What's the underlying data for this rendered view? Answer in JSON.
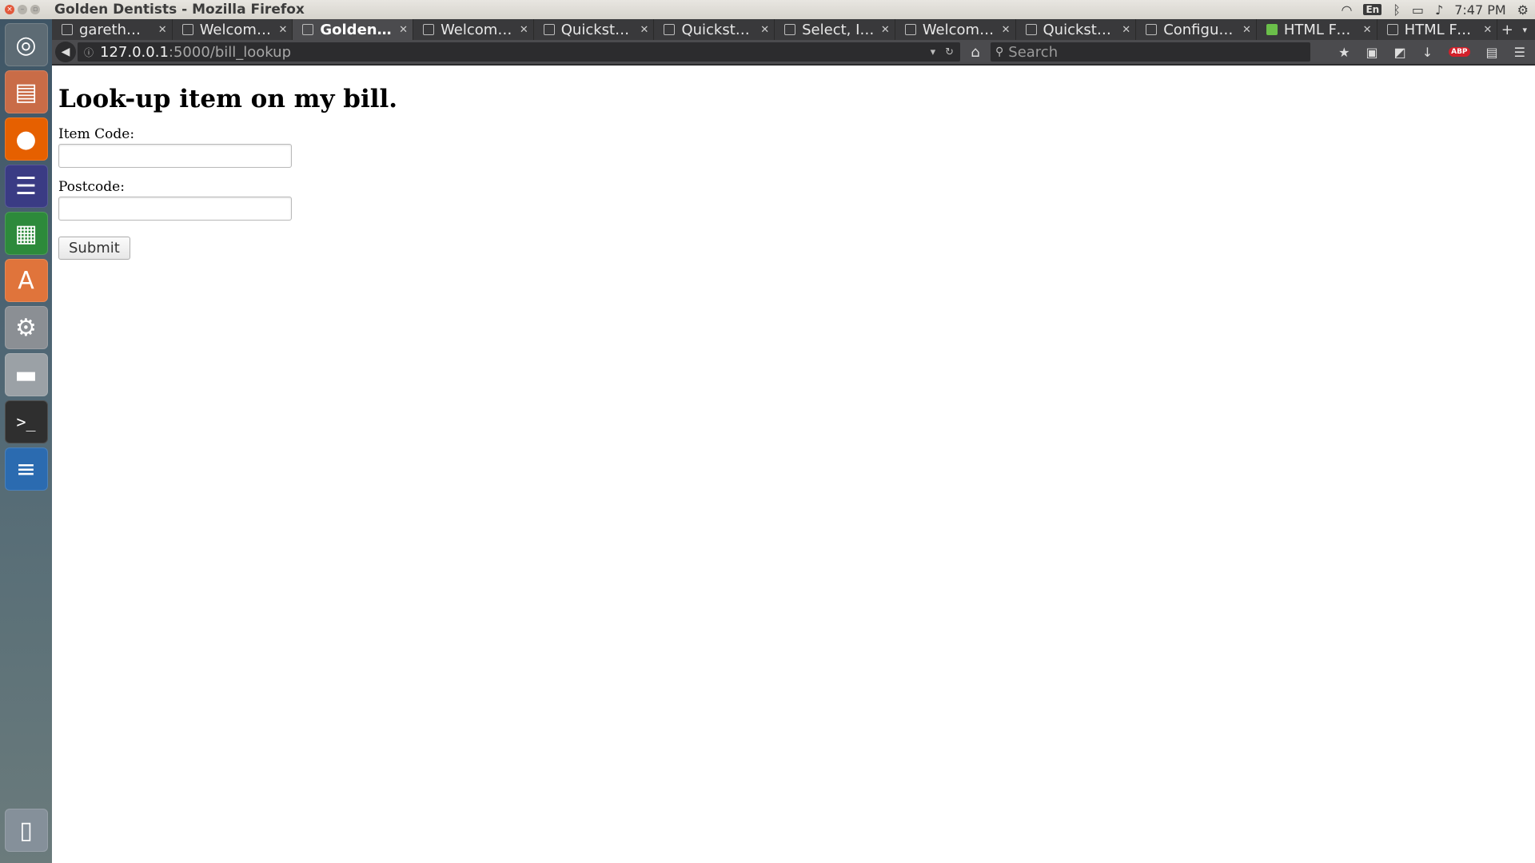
{
  "system": {
    "window_title": "Golden Dentists - Mozilla Firefox",
    "keyboard_layout": "En",
    "clock": "7:47 PM"
  },
  "browser": {
    "tabs": [
      {
        "label": "garethmo…",
        "active": false
      },
      {
        "label": "Welcome…",
        "active": false
      },
      {
        "label": "Golden D…",
        "active": true
      },
      {
        "label": "Welcome…",
        "active": false
      },
      {
        "label": "Quickstar…",
        "active": false
      },
      {
        "label": "Quickstar…",
        "active": false
      },
      {
        "label": "Select, In…",
        "active": false
      },
      {
        "label": "Welcome…",
        "active": false
      },
      {
        "label": "Quickstar…",
        "active": false
      },
      {
        "label": "Configura…",
        "active": false
      },
      {
        "label": "HTML For…",
        "active": false
      },
      {
        "label": "HTML For…",
        "active": false
      }
    ],
    "url_host": "127.0.0.1",
    "url_path": ":5000/bill_lookup",
    "search_placeholder": "Search"
  },
  "launcher": {
    "items": [
      "dash-icon",
      "files-icon",
      "firefox-icon",
      "eclipse-icon",
      "spreadsheet-icon",
      "software-center-icon",
      "system-settings-icon",
      "drive-icon",
      "terminal-icon",
      "document-writer-icon",
      "trash-icon"
    ]
  },
  "page": {
    "heading": "Look-up item on my bill.",
    "item_code_label": "Item Code:",
    "item_code_value": "",
    "postcode_label": "Postcode:",
    "postcode_value": "",
    "submit_label": "Submit"
  }
}
